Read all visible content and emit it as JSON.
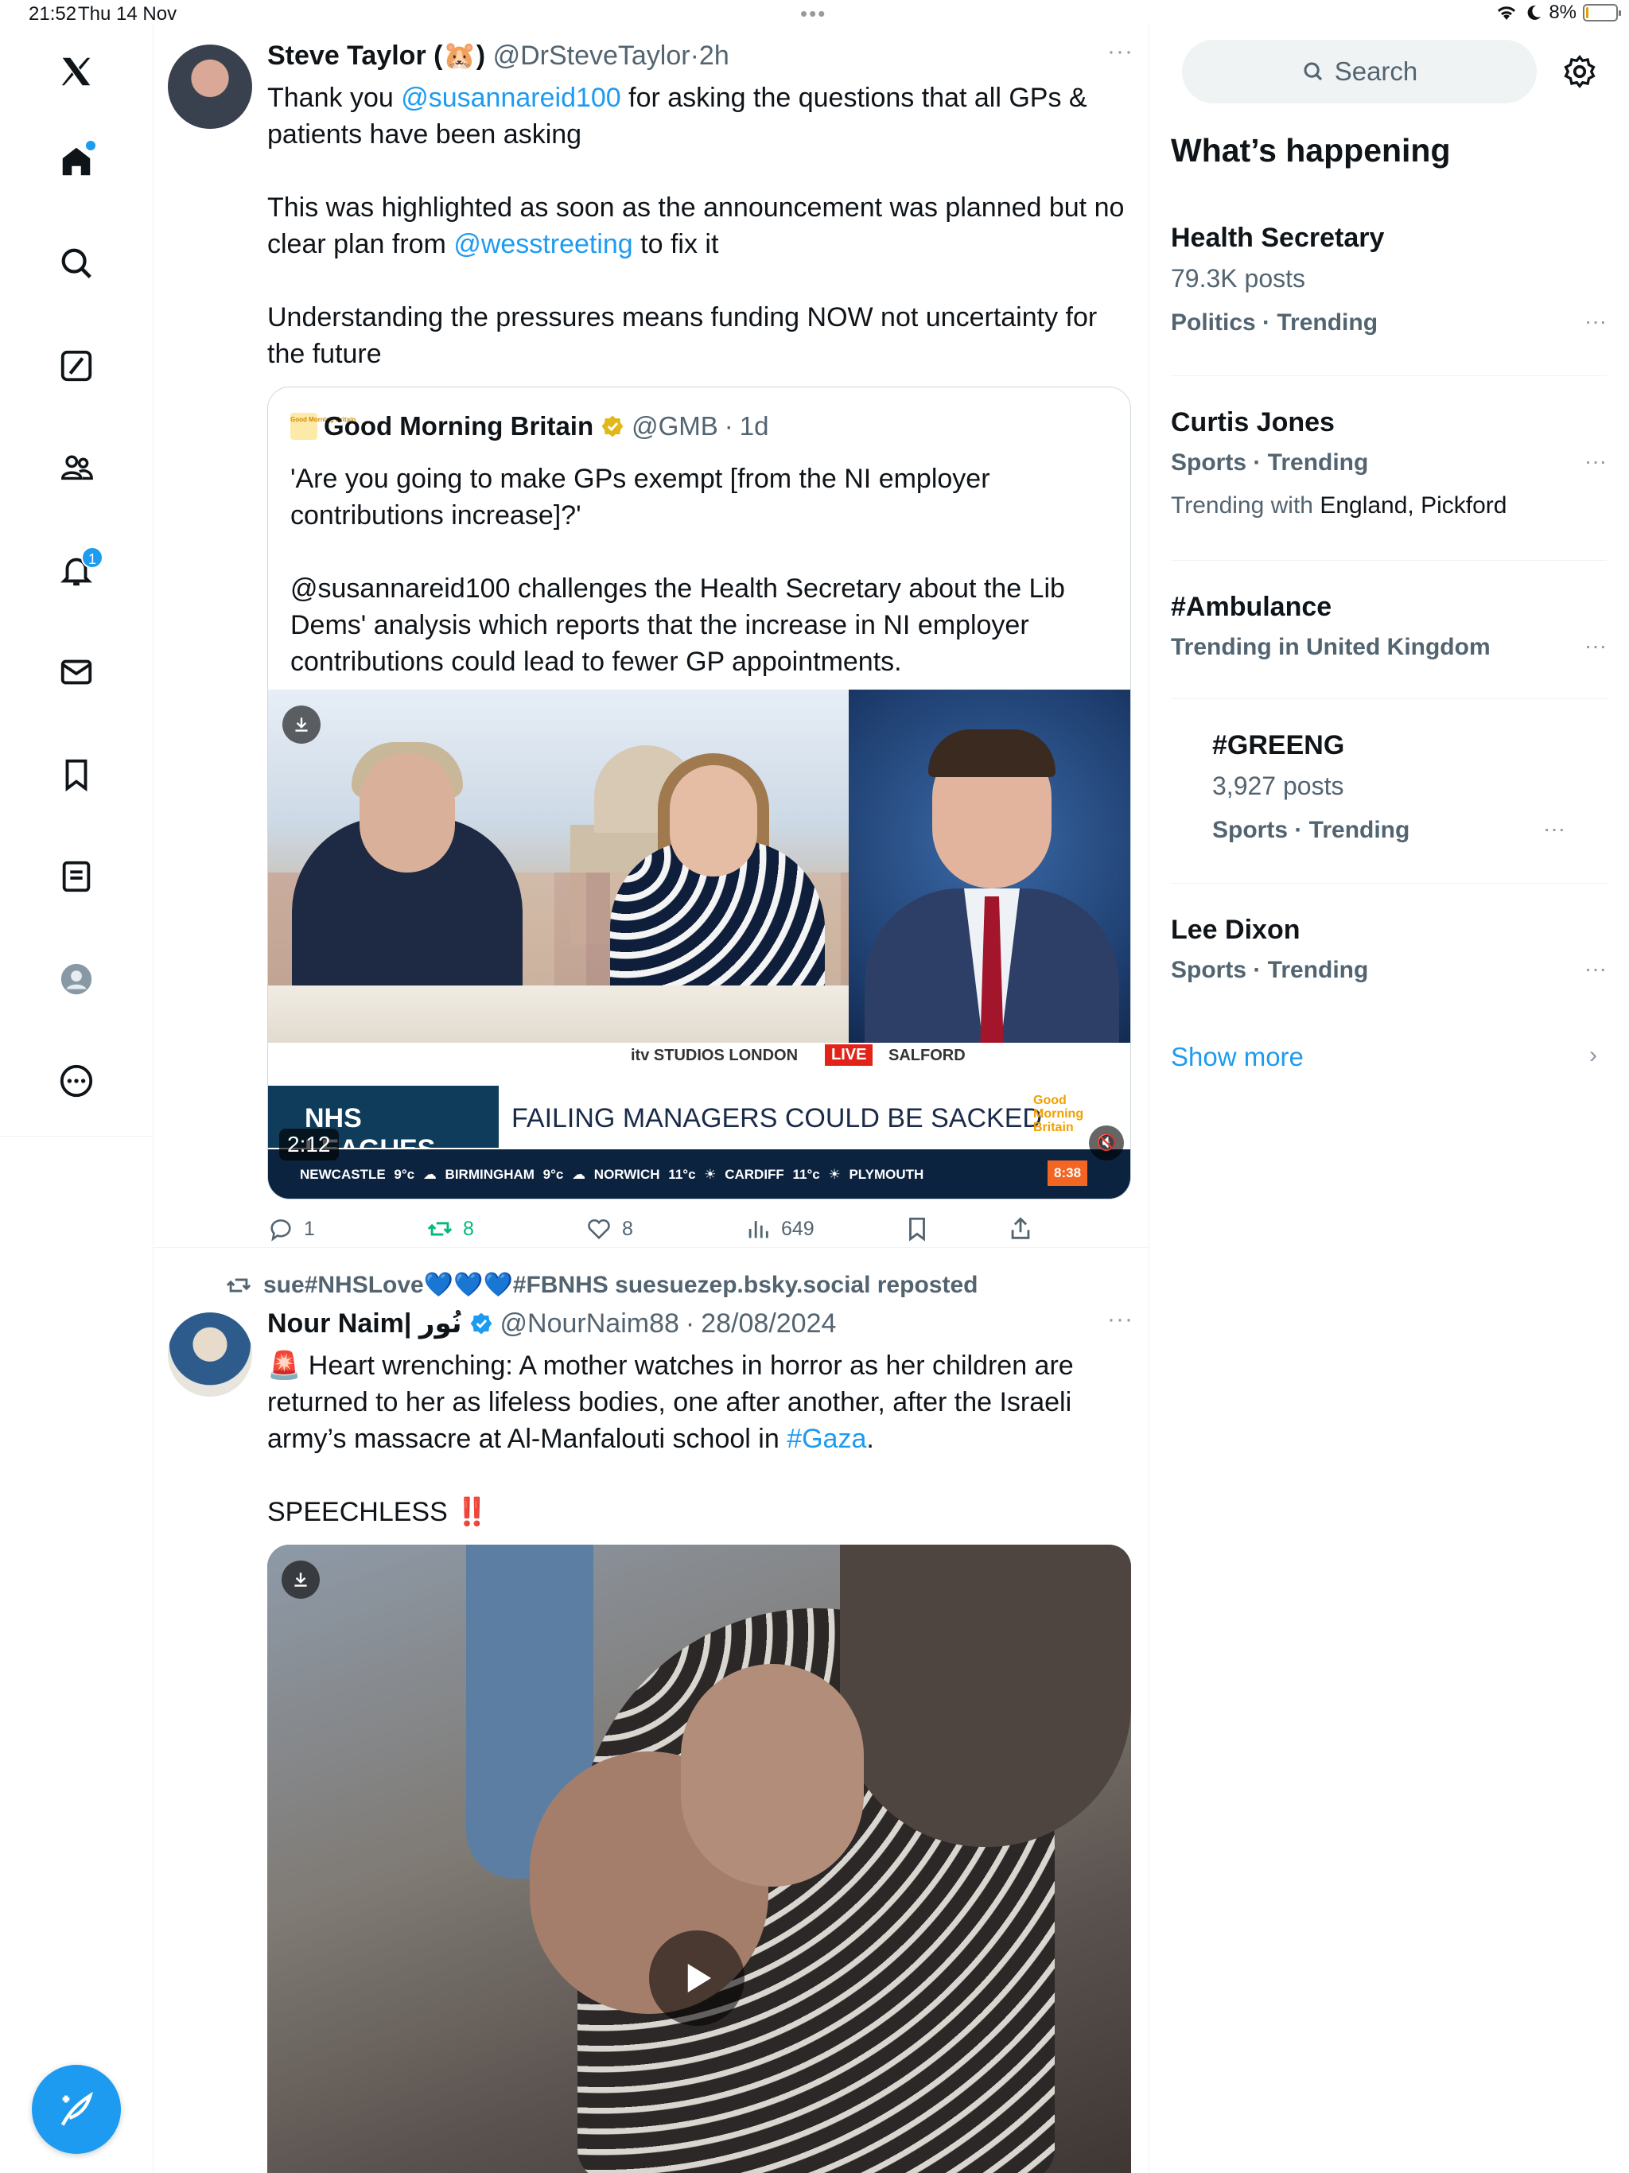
{
  "status_bar": {
    "time": "21:52",
    "date": "Thu 14 Nov",
    "battery": "8%",
    "battery_level": 0.08
  },
  "left_nav": {
    "items": [
      {
        "name": "x-logo-icon"
      },
      {
        "name": "home-icon",
        "dot": true
      },
      {
        "name": "explore-icon"
      },
      {
        "name": "grok-icon"
      },
      {
        "name": "communities-icon"
      },
      {
        "name": "notifications-icon",
        "badge": "1"
      },
      {
        "name": "messages-icon"
      },
      {
        "name": "bookmarks-icon"
      },
      {
        "name": "lists-icon"
      },
      {
        "name": "profile-icon"
      },
      {
        "name": "more-icon"
      }
    ],
    "compose_icon": "compose-feather-icon"
  },
  "timeline": {
    "tweets": [
      {
        "name": "Steve Taylor (🐹)",
        "handle": "@DrSteveTaylor",
        "sep": "·",
        "ago": "2h",
        "text_parts": {
          "p1a": "Thank you ",
          "mention1": "@susannareid100",
          "p1b": " for asking the questions that all GPs & patients have been asking",
          "p2a": "This was highlighted as soon as the announcement was planned but no clear plan from ",
          "mention2": "@wesstreeting",
          "p2b": " to fix it",
          "p3": "Understanding the pressures means funding NOW not uncertainty for the future"
        },
        "quote": {
          "logo_text": "Good Morning Britain",
          "name": "Good Morning Britain",
          "handle": "@GMB",
          "sep": "·",
          "ago": "1d",
          "text": "'Are you going to make GPs exempt [from the NI employer contributions increase]?'\n\n@susannareid100 challenges the Health Secretary about the Lib Dems' analysis which reports that the increase in NI employer contributions could lead to fewer GP appointments.",
          "video": {
            "location_left": "itv STUDIOS LONDON",
            "live": "LIVE",
            "location_right": "SALFORD",
            "banner_tag": "NHS LEAGUES",
            "banner_headline": "FAILING MANAGERS COULD BE SACKED",
            "banner_brand": "Good Morning Britain",
            "weather": "NEWCASTLE 9°c   ☁ BIRMINGHAM 9°c   ☁ NORWICH 11°c   ☀ CARDIFF 11°c   ☀ PLYMOUTH",
            "clock": "8:38",
            "duration": "2:12"
          }
        },
        "actions": {
          "replies": "1",
          "reposts": "8",
          "likes": "8",
          "views": "649"
        }
      },
      {
        "repost_by": "sue#NHSLove💙💙💙#FBNHS suesuezep.bsky.social reposted",
        "name": "Nour Naim| نُور",
        "handle": "@NourNaim88",
        "sep": "·",
        "ago": "28/08/2024",
        "text_parts": {
          "siren": "🚨",
          "p1a": " Heart wrenching: A mother watches in horror as her children are returned to her as lifeless bodies, one after another, after the Israeli army’s massacre at Al-Manfalouti school in ",
          "hashtag": "#Gaza",
          "p1b": ".",
          "p2": "SPEECHLESS ",
          "bang": "‼️"
        }
      }
    ]
  },
  "sidebar": {
    "search_placeholder": "Search",
    "title": "What’s happening",
    "trends": [
      {
        "name": "Health Secretary",
        "count": "79.3K posts",
        "category": "Politics · Trending"
      },
      {
        "name": "Curtis Jones",
        "category": "Sports · Trending",
        "with_prefix": "Trending with ",
        "with_names": "England, Pickford"
      },
      {
        "name": "#Ambulance",
        "category": "Trending in United Kingdom"
      },
      {
        "name": "#GREENG",
        "count": "3,927 posts",
        "category": "Sports · Trending"
      },
      {
        "name": "Lee Dixon",
        "category": "Sports · Trending"
      }
    ],
    "show_more": "Show more",
    "more_dots": "···"
  },
  "colors": {
    "accent": "#1d9bf0",
    "repost_green": "#00ba7c",
    "text": "#0f1419",
    "muted": "#536471"
  }
}
